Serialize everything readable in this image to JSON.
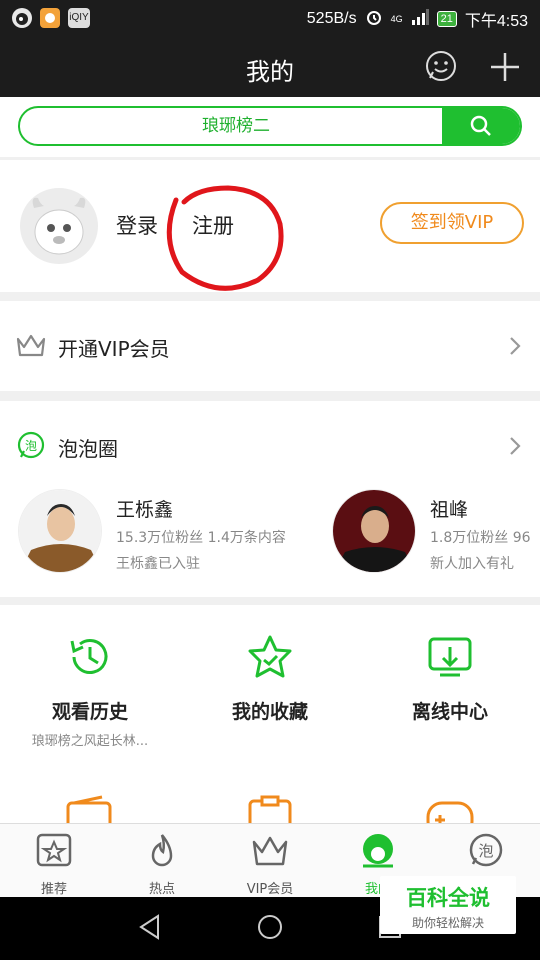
{
  "status_bar": {
    "speed": "525B/s",
    "signal": "4G",
    "battery": "21",
    "time": "下午4:53",
    "notif_icons": [
      "weibo-icon",
      "taobao-icon",
      "iqiyi-icon"
    ],
    "iqiyi_text": "iQIY"
  },
  "header": {
    "title": "我的"
  },
  "search": {
    "placeholder": "琅琊榜二"
  },
  "profile": {
    "login_label": "登录",
    "register_label": "注册",
    "vip_button": "签到领VIP"
  },
  "vip_row": {
    "label": "开通VIP会员"
  },
  "bubble": {
    "label": "泡泡圈",
    "stars": [
      {
        "name": "王栎鑫",
        "meta": "15.3万位粉丝 1.4万条内容",
        "note": "王栎鑫已入驻"
      },
      {
        "name": "祖峰",
        "meta": "1.8万位粉丝 96",
        "note": "新人加入有礼"
      }
    ]
  },
  "tools": [
    {
      "title": "观看历史",
      "sub": "琅琊榜之风起长林...",
      "icon": "history-clock-icon"
    },
    {
      "title": "我的收藏",
      "sub": "",
      "icon": "favorite-star-icon"
    },
    {
      "title": "离线中心",
      "sub": "",
      "icon": "offline-download-icon"
    }
  ],
  "tabs": [
    {
      "label": "推荐",
      "icon": "recommend-icon",
      "active": false
    },
    {
      "label": "热点",
      "icon": "hot-fire-icon",
      "active": false
    },
    {
      "label": "VIP会员",
      "icon": "vip-crown-icon",
      "active": false
    },
    {
      "label": "我的",
      "icon": "my-profile-icon",
      "active": true
    },
    {
      "label": "",
      "icon": "bubble-icon",
      "active": false
    }
  ],
  "watermark": {
    "title": "百科全说",
    "subtitle": "助你轻松解决"
  },
  "colors": {
    "accent": "#1fbf30",
    "orange": "#f08a1c",
    "annotation_red": "#e0161b",
    "header_bg": "#1c1c1c"
  }
}
